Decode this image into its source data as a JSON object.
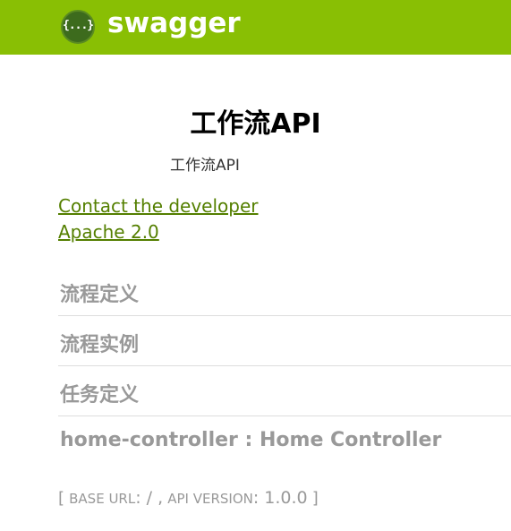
{
  "header": {
    "logo_glyph": "{...}",
    "logo_text": "swagger",
    "background_color": "#89bf04"
  },
  "info": {
    "title": "工作流API",
    "description": "工作流API",
    "contact_link": "Contact the developer",
    "license_link": "Apache 2.0",
    "link_color": "#547f00"
  },
  "resources": [
    {
      "label": "流程定义"
    },
    {
      "label": "流程实例"
    },
    {
      "label": "任务定义"
    },
    {
      "label": "home-controller : Home Controller"
    }
  ],
  "footer": {
    "open_bracket": "[",
    "base_url_label": "BASE URL",
    "base_url_value": ": / ,",
    "api_version_label": "API VERSION",
    "api_version_value": ": 1.0.0",
    "close_bracket": "]"
  }
}
